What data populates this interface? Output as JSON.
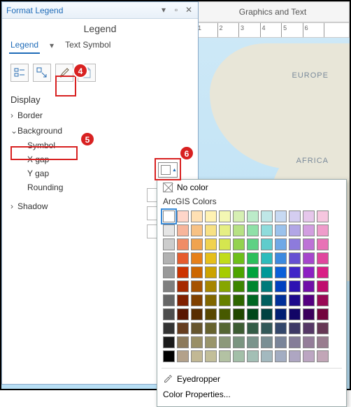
{
  "ribbon": {
    "group_label": "Graphics and Text"
  },
  "ruler": {
    "start": 1,
    "marks": [
      "1",
      "2",
      "3",
      "4",
      "5",
      "6"
    ]
  },
  "map": {
    "label_europe": "EUROPE",
    "label_africa": "AFRICA"
  },
  "panel": {
    "title": "Format Legend",
    "subtitle": "Legend",
    "tabs": {
      "legend": "Legend",
      "text_symbol": "Text Symbol"
    },
    "section": "Display",
    "items": {
      "border": "Border",
      "background": "Background",
      "symbol": "Symbol",
      "xgap": "X gap",
      "ygap": "Y gap",
      "rounding": "Rounding",
      "shadow": "Shadow"
    }
  },
  "callouts": {
    "c4": "4",
    "c5": "5",
    "c6": "6"
  },
  "popup": {
    "no_color": "No color",
    "palette_label": "ArcGIS Colors",
    "eyedropper": "Eyedropper",
    "color_props": "Color Properties...",
    "colors": [
      "#ffffff",
      "#ffd6c9",
      "#ffe0b3",
      "#fff2b3",
      "#f3f7b3",
      "#d6efb3",
      "#bcebc9",
      "#bfe7e7",
      "#c7d9f2",
      "#d4cdf0",
      "#e6c7eb",
      "#f6c6df",
      "#e5e5e5",
      "#f7b59b",
      "#f7c184",
      "#f7e184",
      "#e6ef84",
      "#b7e184",
      "#8fe0a8",
      "#8fdcdc",
      "#9bc2ec",
      "#b2a6e6",
      "#d29ee0",
      "#ef9ccb",
      "#cccccc",
      "#f08c66",
      "#f0a34f",
      "#f0d24f",
      "#d5e64f",
      "#93d24f",
      "#5fd184",
      "#5fcccc",
      "#6fa8e6",
      "#8d7bdc",
      "#bd72d6",
      "#e872b6",
      "#b2b2b2",
      "#e65c2e",
      "#e6801a",
      "#e6bf1a",
      "#c1dc1a",
      "#6ebf1a",
      "#2ebf5c",
      "#2ebcbc",
      "#3d8ae0",
      "#6650d2",
      "#a647cc",
      "#e0479e",
      "#999999",
      "#cc3300",
      "#cc6600",
      "#cca300",
      "#a6cc00",
      "#4da300",
      "#00a33d",
      "#009999",
      "#0a5fd9",
      "#4026c8",
      "#8c1fc2",
      "#d91f86",
      "#7f7f7f",
      "#a62900",
      "#a65200",
      "#a68500",
      "#86a600",
      "#3d8500",
      "#00852e",
      "#007a7a",
      "#003fbf",
      "#2d13b2",
      "#700fa8",
      "#bf0f6e",
      "#666666",
      "#802000",
      "#804000",
      "#806600",
      "#668000",
      "#2e6600",
      "#006622",
      "#005e5e",
      "#002f99",
      "#1e0a8c",
      "#540080",
      "#990a55",
      "#4d4d4d",
      "#591600",
      "#592d00",
      "#594700",
      "#475900",
      "#204700",
      "#00471a",
      "#004242",
      "#001f73",
      "#120566",
      "#3b005c",
      "#73053d",
      "#333333",
      "#663d1f",
      "#66552e",
      "#66622e",
      "#556633",
      "#3d5c33",
      "#335c47",
      "#335959",
      "#33476b",
      "#3d3866",
      "#553866",
      "#663855",
      "#1a1a1a",
      "#8c7a5c",
      "#998f66",
      "#99956b",
      "#8c997a",
      "#7a9480",
      "#7a948c",
      "#7a8f94",
      "#7a8599",
      "#857d99",
      "#947d99",
      "#997d8f",
      "#000000",
      "#b3a18a",
      "#c2b894",
      "#c2be99",
      "#b3c2a3",
      "#a3bfa8",
      "#a3bfb5",
      "#a3b9bf",
      "#a3adc2",
      "#aea6c2",
      "#bca6c2",
      "#c2a6b7"
    ]
  }
}
